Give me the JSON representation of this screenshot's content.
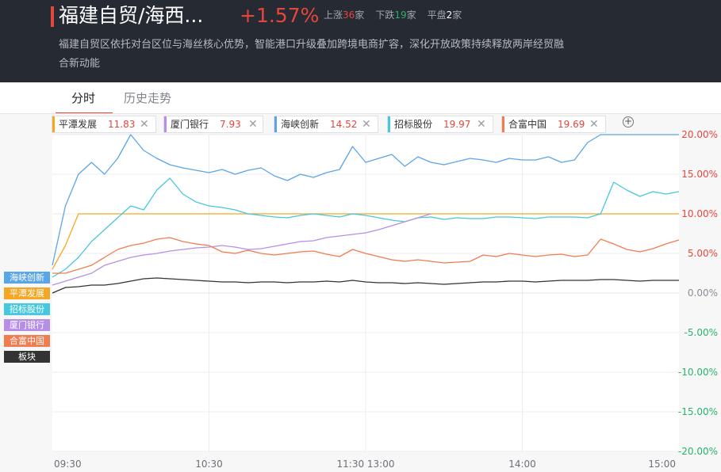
{
  "header": {
    "title": "福建自贸/海西...",
    "change": "+1.57%",
    "up_label": "上涨",
    "up_count": "36",
    "up_unit": "家",
    "down_label": "下跌",
    "down_count": "19",
    "down_unit": "家",
    "flat_label": "平盘",
    "flat_count": "2",
    "flat_unit": "家",
    "description": "福建自贸区依托对台区位与海丝核心优势，智能港口升级叠加跨境电商扩容，深化开放政策持续释放两岸经贸融合新动能"
  },
  "tabs": [
    {
      "label": "分时",
      "active": true
    },
    {
      "label": "历史走势",
      "active": false
    }
  ],
  "compare_chips": [
    {
      "name": "平潭发展",
      "value": "11.83",
      "color": "#f5a623"
    },
    {
      "name": "厦门银行",
      "value": "7.93",
      "color": "#b68ee8"
    },
    {
      "name": "海峡创新",
      "value": "14.52",
      "color": "#5aa5e8"
    },
    {
      "name": "招标股份",
      "value": "19.97",
      "color": "#45c8de"
    },
    {
      "name": "合富中国",
      "value": "19.69",
      "color": "#f07c4f"
    }
  ],
  "add_icon": "plus-circle-icon",
  "close_icon": "close-icon",
  "chart_data": {
    "type": "line",
    "title": "",
    "xlabel": "",
    "ylabel": "",
    "x_ticks": [
      "09:30",
      "10:30",
      "11:30 13:00",
      "14:00",
      "15:00"
    ],
    "y_ticks": [
      "20.00%",
      "15.00%",
      "10.00%",
      "5.00%",
      "0.00%",
      "-5.00%",
      "-10.00%",
      "-15.00%",
      "-20.00%"
    ],
    "ylim": [
      -20,
      20
    ],
    "grid": true,
    "legend": [
      "海峡创新",
      "平潭发展",
      "招标股份",
      "厦门银行",
      "合富中国",
      "板块"
    ],
    "x_minutes": [
      0,
      5,
      10,
      15,
      20,
      25,
      30,
      35,
      40,
      45,
      50,
      55,
      60,
      65,
      70,
      75,
      80,
      85,
      90,
      95,
      100,
      105,
      110,
      115,
      120,
      125,
      130,
      135,
      140,
      145,
      150,
      155,
      160,
      165,
      170,
      175,
      180,
      185,
      190,
      195,
      200,
      205,
      210,
      215,
      220,
      225,
      230,
      235,
      240
    ],
    "series": [
      {
        "name": "海峡创新",
        "color": "#5aa5e8",
        "values": [
          3.5,
          11.0,
          15.0,
          16.5,
          15.0,
          17.0,
          20.0,
          18.0,
          17.0,
          16.2,
          15.8,
          15.5,
          15.2,
          15.6,
          15.0,
          15.5,
          15.8,
          14.8,
          14.2,
          15.0,
          14.6,
          15.2,
          15.6,
          18.5,
          16.5,
          17.0,
          17.5,
          16.0,
          17.2,
          16.5,
          16.2,
          16.6,
          17.0,
          16.8,
          16.5,
          17.0,
          16.8,
          16.8,
          17.2,
          16.5,
          16.8,
          19.0,
          20.0,
          20.0,
          20.0,
          20.0,
          20.0,
          20.0,
          20.0
        ]
      },
      {
        "name": "平潭发展",
        "color": "#f5a623",
        "values": [
          3.0,
          6.0,
          10.0,
          10.0,
          10.0,
          10.0,
          10.0,
          10.0,
          10.0,
          10.0,
          10.0,
          10.0,
          10.0,
          10.0,
          10.0,
          10.0,
          10.0,
          10.0,
          10.0,
          10.0,
          10.0,
          10.0,
          10.0,
          10.0,
          10.0,
          10.0,
          10.0,
          10.0,
          10.0,
          10.0,
          10.0,
          10.0,
          10.0,
          10.0,
          10.0,
          10.0,
          10.0,
          10.0,
          10.0,
          10.0,
          10.0,
          10.0,
          10.0,
          10.0,
          10.0,
          10.0,
          10.0,
          10.0,
          10.0
        ]
      },
      {
        "name": "招标股份",
        "color": "#45c8de",
        "values": [
          2.0,
          3.0,
          4.5,
          6.5,
          8.0,
          9.5,
          11.0,
          10.5,
          13.0,
          14.5,
          12.5,
          11.5,
          11.0,
          10.8,
          10.5,
          10.0,
          9.8,
          9.6,
          9.5,
          9.8,
          10.0,
          9.8,
          9.6,
          10.0,
          9.8,
          9.5,
          9.2,
          9.0,
          9.5,
          9.6,
          9.3,
          9.5,
          9.4,
          9.4,
          9.6,
          9.6,
          9.5,
          9.4,
          9.6,
          9.6,
          9.6,
          9.5,
          10.0,
          14.0,
          13.0,
          12.2,
          12.8,
          12.5,
          12.8
        ]
      },
      {
        "name": "厦门银行",
        "color": "#b68ee8",
        "values": [
          1.0,
          1.5,
          2.0,
          2.5,
          3.5,
          4.0,
          4.5,
          4.8,
          5.0,
          5.3,
          5.5,
          5.7,
          5.8,
          6.0,
          5.8,
          5.5,
          5.6,
          5.9,
          6.2,
          6.5,
          6.6,
          7.0,
          7.2,
          7.4,
          7.6,
          8.0,
          8.5,
          9.0,
          9.5,
          10.0,
          null,
          null,
          null,
          null,
          null,
          null,
          null,
          null,
          null,
          null,
          null,
          null,
          null,
          null,
          null,
          null,
          null,
          null,
          null
        ]
      },
      {
        "name": "合富中国",
        "color": "#f07c4f",
        "values": [
          2.5,
          2.5,
          3.0,
          3.5,
          4.5,
          5.5,
          6.0,
          6.3,
          6.8,
          7.0,
          6.5,
          6.2,
          6.0,
          5.2,
          5.0,
          5.4,
          5.0,
          4.8,
          5.0,
          5.2,
          5.3,
          4.9,
          4.6,
          5.5,
          5.0,
          4.6,
          4.2,
          4.0,
          4.2,
          4.0,
          3.8,
          3.9,
          4.0,
          4.8,
          4.6,
          5.0,
          4.8,
          4.6,
          4.8,
          4.9,
          4.6,
          4.8,
          6.8,
          6.2,
          5.5,
          5.2,
          5.6,
          6.2,
          6.7
        ]
      },
      {
        "name": "板块",
        "color": "#333333",
        "values": [
          0.0,
          0.7,
          0.8,
          1.0,
          1.0,
          1.2,
          1.5,
          1.8,
          1.9,
          1.8,
          1.7,
          1.6,
          1.5,
          1.4,
          1.4,
          1.3,
          1.4,
          1.4,
          1.3,
          1.4,
          1.4,
          1.5,
          1.4,
          1.6,
          1.4,
          1.3,
          1.3,
          1.2,
          1.3,
          1.2,
          1.1,
          1.2,
          1.3,
          1.4,
          1.4,
          1.5,
          1.5,
          1.4,
          1.5,
          1.6,
          1.6,
          1.6,
          1.7,
          1.7,
          1.6,
          1.5,
          1.6,
          1.6,
          1.6
        ]
      }
    ]
  }
}
